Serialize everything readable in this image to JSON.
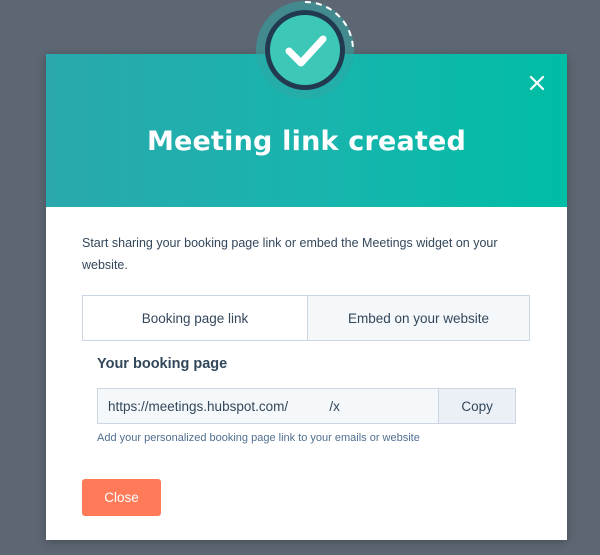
{
  "modal": {
    "title": "Meeting link created",
    "description": "Start sharing your booking page link or embed the Meetings widget on your website.",
    "tabs": [
      {
        "label": "Booking page link",
        "active": true
      },
      {
        "label": "Embed on your website",
        "active": false
      }
    ],
    "booking": {
      "section_label": "Your booking page",
      "url_value": "https://meetings.hubspot.com/           /x",
      "copy_label": "Copy",
      "helper_text": "Add your personalized booking page link to your emails or website"
    },
    "close_label": "Close",
    "icons": {
      "close": "close-icon",
      "success": "checkmark-icon"
    }
  },
  "colors": {
    "header_start": "#2aa8ad",
    "header_end": "#00bda5",
    "primary_button": "#ff7a59",
    "text": "#33475b",
    "backdrop": "#5b6572",
    "badge_fill": "#1fb1a6"
  }
}
